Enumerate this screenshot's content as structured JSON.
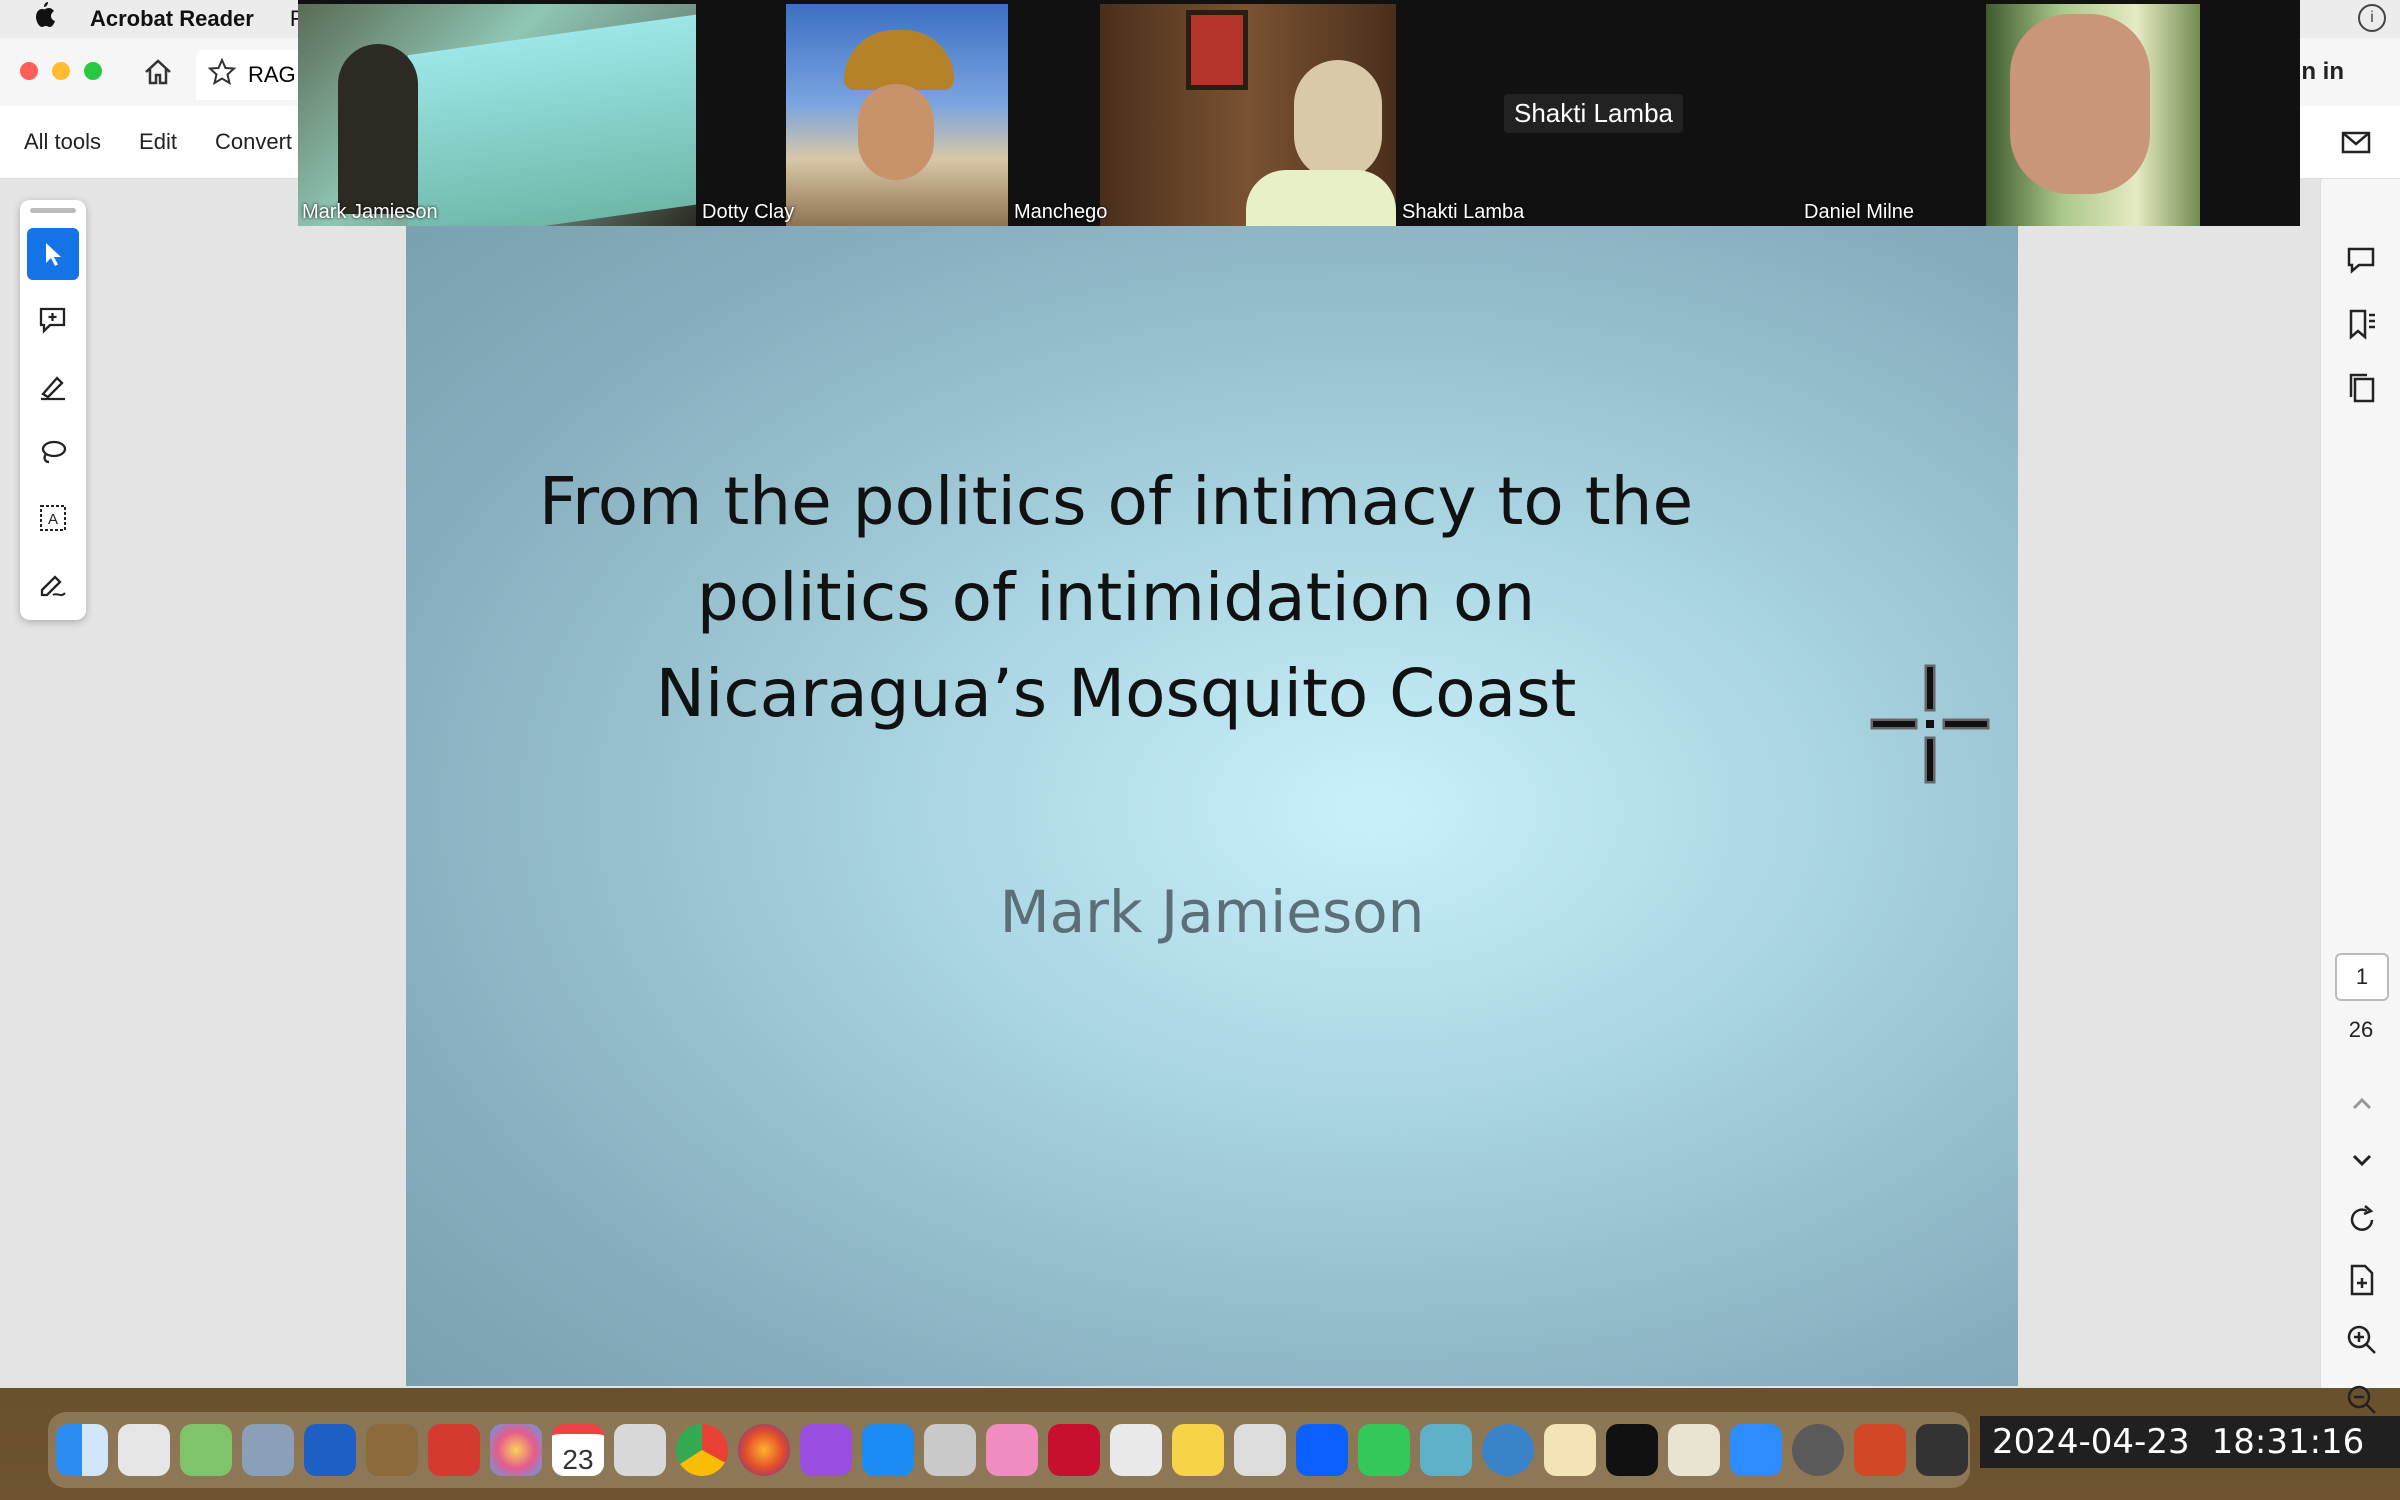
{
  "menubar": {
    "app_name": "Acrobat Reader",
    "next_menu": "F"
  },
  "window": {
    "tab_label": "RAG",
    "sign_in": "Sign in",
    "toolbar": {
      "all_tools": "All tools",
      "edit": "Edit",
      "convert": "Convert"
    }
  },
  "slide": {
    "title": "From the politics of intimacy to  the politics of intimidation on Nicaragua’s Mosquito Coast",
    "author": "Mark Jamieson"
  },
  "pagination": {
    "current_page": "1",
    "total_pages": "26"
  },
  "participants": [
    {
      "name": "Mark Jamieson"
    },
    {
      "name": "Dotty Clay"
    },
    {
      "name": "Manchego"
    },
    {
      "name": "Shakti Lamba",
      "nameplate": "Shakti Lamba"
    },
    {
      "name": "Daniel Milne"
    }
  ],
  "dock": {
    "calendar_day": "23"
  },
  "overlay": {
    "date": "2024-04-23",
    "time": "18:31:16"
  },
  "colors": {
    "accent": "#1473e6",
    "slide_center": "#c9f1fb",
    "slide_edge": "#7a9fae",
    "zoom_bg": "#111111"
  },
  "icons": [
    "apple-icon",
    "home-icon",
    "star-icon",
    "select-arrow-icon",
    "add-comment-icon",
    "highlight-pen-icon",
    "lasso-icon",
    "text-select-icon",
    "sign-pen-icon",
    "mail-icon",
    "comment-icon",
    "bookmark-icon",
    "pages-icon",
    "chevron-up-icon",
    "chevron-down-icon",
    "rotate-icon",
    "document-export-icon",
    "zoom-in-icon",
    "zoom-out-icon",
    "crosshair-cursor-icon"
  ]
}
